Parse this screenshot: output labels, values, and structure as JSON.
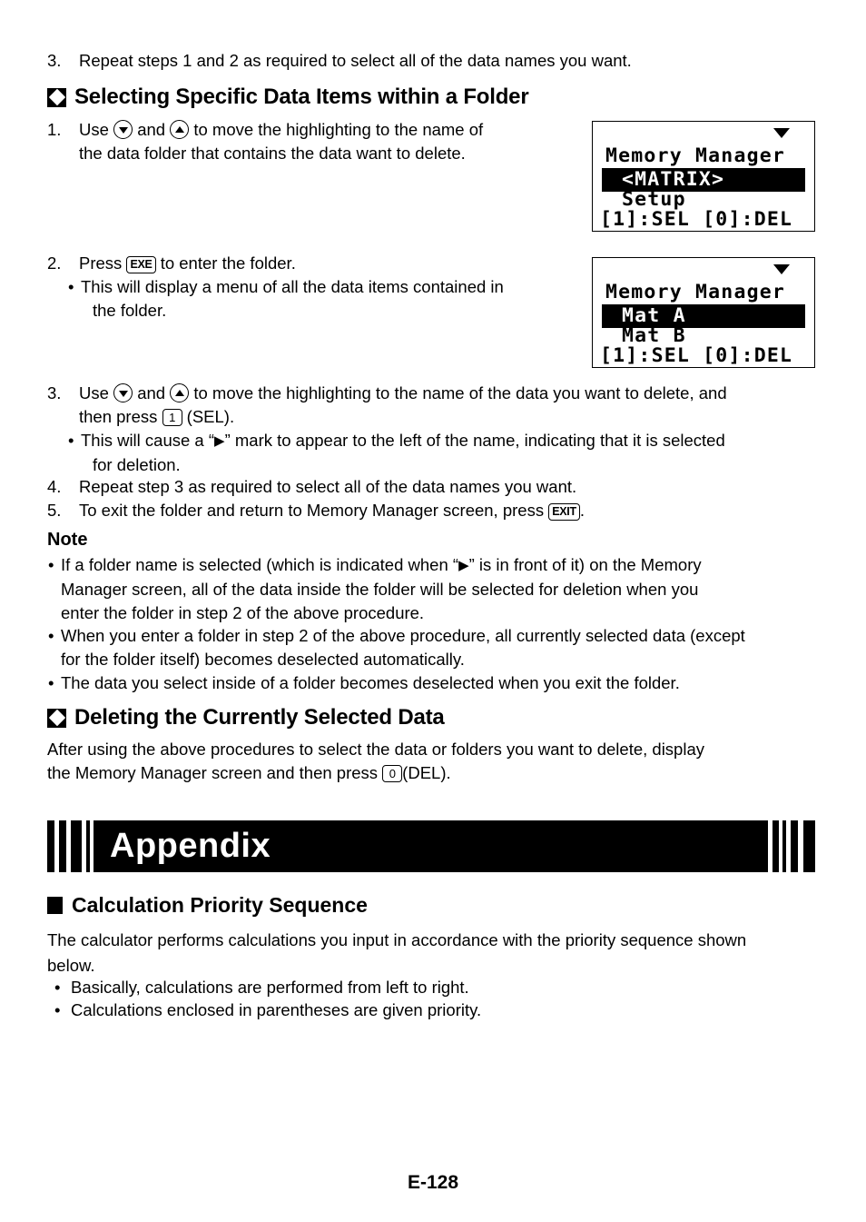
{
  "document": {
    "footer_page": "E-128"
  },
  "step3_top": {
    "number": "3.",
    "text": "Repeat steps 1 and 2 as required to select all of the data names you want."
  },
  "section_selecting": {
    "heading": "Selecting Specific Data Items within a Folder",
    "step1": {
      "number": "1.",
      "prefix": "Use",
      "key_down": "down-arrow-key",
      "mid": "and",
      "key_up": "up-arrow-key",
      "line1_rest": "to move the highlighting to the name of",
      "line2": "the data folder that contains the data want to delete."
    },
    "step2": {
      "number": "2.",
      "prefix": "Press",
      "key": "EXE",
      "suffix": "to enter the folder.",
      "bullet1_line1": "This will display a menu of all the data items contained in",
      "bullet1_line2": "the folder."
    },
    "step3": {
      "number": "3.",
      "prefix": "Use",
      "key_down": "down-arrow-key",
      "mid": "and",
      "key_up": "up-arrow-key",
      "line1_rest": "to move the highlighting to the name of the data you want to delete, and",
      "line2_prefix": "then press",
      "line2_key": "1",
      "line2_suffix": "(SEL).",
      "bullet_line1_a": "This will cause a “",
      "bullet_line1_mark": "▶",
      "bullet_line1_b": "” mark to appear to the left of the name, indicating that it is selected",
      "bullet_line2": "for deletion."
    },
    "step4": {
      "number": "4.",
      "text": "Repeat step 3 as required to select all of the data names you want."
    },
    "step5": {
      "number": "5.",
      "prefix": "To exit the folder and return to Memory Manager screen, press",
      "key": "EXIT",
      "suffix": "."
    },
    "note": {
      "heading": "Note",
      "items": [
        {
          "line1_a": "If a folder name is selected (which is indicated when “",
          "mark": "▶",
          "line1_b": "” is in front of it) on the Memory",
          "line2": "Manager screen, all of the data inside the folder will be selected for deletion when you",
          "line3": "enter the folder in step 2 of the above procedure."
        },
        {
          "line1_a": "When you enter a folder in step 2 of the above procedure, all currently selected data (except",
          "mark": "",
          "line1_b": "",
          "line2": "for the folder itself) becomes deselected automatically.",
          "line3": ""
        },
        {
          "line1_a": "The data you select inside of a folder becomes deselected when you exit the folder.",
          "mark": "",
          "line1_b": "",
          "line2": "",
          "line3": ""
        }
      ]
    }
  },
  "lcd_screens": [
    {
      "name": "memory-manager-folder-list",
      "status_icon": "down-triangle-indicator",
      "line1": "Memory Manager",
      "line2_highlighted": "<MATRIX>",
      "line3": "Setup",
      "line4": "[1]:SEL [0]:DEL"
    },
    {
      "name": "memory-manager-item-list",
      "status_icon": "down-triangle-indicator",
      "line1": "Memory Manager",
      "line2_highlighted": "Mat A",
      "line3": "Mat B",
      "line4": "[1]:SEL [0]:DEL"
    }
  ],
  "section_deleting": {
    "heading": "Deleting the Currently Selected Data",
    "line1": "After using the above procedures to select the data or folders you want to delete, display",
    "line2_prefix": "the Memory Manager screen and then press",
    "line2_key": "0",
    "line2_suffix": "(DEL)."
  },
  "appendix": {
    "title": "Appendix"
  },
  "section_priority": {
    "heading": "Calculation Priority Sequence",
    "intro_line1": "The calculator performs calculations you input in accordance with the priority sequence shown",
    "intro_line2": "below.",
    "bullets": [
      "Basically, calculations are performed from left to right.",
      "Calculations enclosed in parentheses are given priority."
    ]
  }
}
